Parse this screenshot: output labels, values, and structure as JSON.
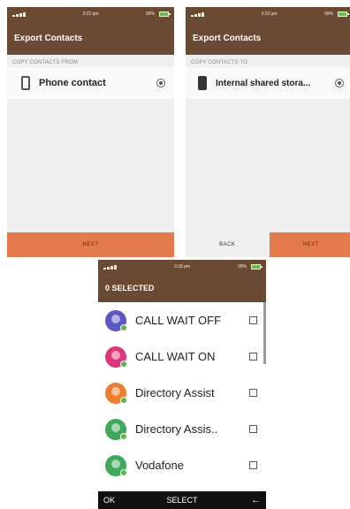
{
  "screen1": {
    "status_time": "3:22 pm",
    "battery": "99%",
    "title": "Export Contacts",
    "section_label": "COPY CONTACTS FROM",
    "option_label": "Phone contact",
    "footer_button": "NEXT"
  },
  "screen2": {
    "status_time": "3:23 pm",
    "battery": "99%",
    "title": "Export Contacts",
    "section_label": "COPY CONTACTS TO",
    "option_label": "Internal shared stora...",
    "back_button": "BACK",
    "next_button": "NEXT"
  },
  "screen3": {
    "status_time": "3:18 pm",
    "battery": "99%",
    "title": "0 SELECTED",
    "contacts": [
      {
        "name": "CALL WAIT OFF",
        "color": "#5b57c4"
      },
      {
        "name": "CALL WAIT ON",
        "color": "#e0357a"
      },
      {
        "name": "Directory Assist",
        "color": "#ee7d2f"
      },
      {
        "name": "Directory Assis..",
        "color": "#3fa85a"
      },
      {
        "name": "Vodafone",
        "color": "#3fa85a"
      }
    ],
    "softkey_left": "OK",
    "softkey_center": "SELECT",
    "softkey_right_icon": "back-arrow-icon"
  }
}
